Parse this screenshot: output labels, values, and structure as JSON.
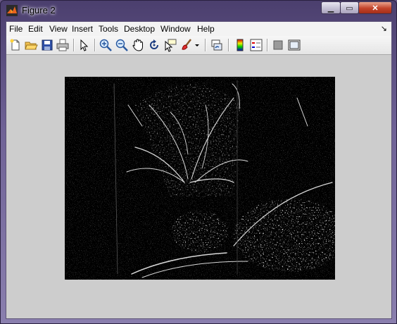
{
  "window": {
    "title": "Figure 2"
  },
  "title_buttons": {
    "minimize": "▁",
    "maximize": "▭",
    "close": "✕"
  },
  "menubar": {
    "items": [
      "File",
      "Edit",
      "View",
      "Insert",
      "Tools",
      "Desktop",
      "Window",
      "Help"
    ],
    "dock_glyph": "↘"
  },
  "toolbar": {
    "buttons": [
      "new-figure-icon",
      "open-file-icon",
      "save-icon",
      "print-icon",
      "edit-plot-arrow-icon",
      "zoom-in-icon",
      "zoom-out-icon",
      "pan-hand-icon",
      "rotate-3d-icon",
      "data-cursor-icon",
      "brush-icon",
      "link-plot-icon",
      "insert-colorbar-icon",
      "insert-legend-icon",
      "hide-plot-tools-icon",
      "show-plot-tools-icon"
    ]
  },
  "colors": {
    "client_bg": "#cdcdcd",
    "menubar_bg": "#f3f3f3",
    "image_bg": "#000000"
  }
}
